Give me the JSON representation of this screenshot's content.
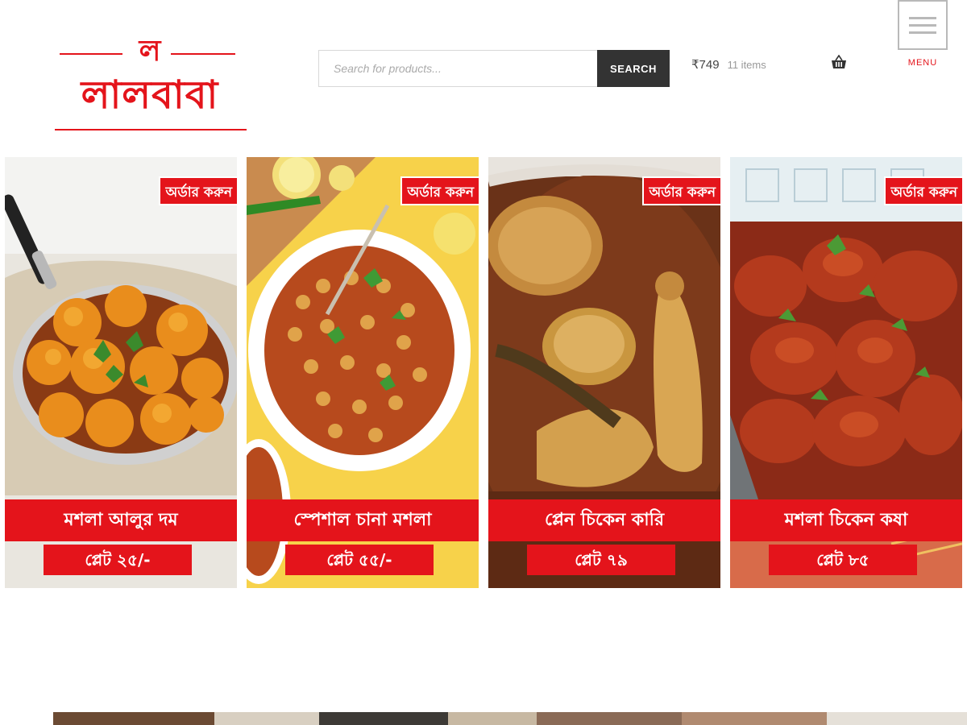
{
  "header": {
    "logo_top": "ল",
    "logo_main": "লালবাবা"
  },
  "search": {
    "placeholder": "Search for products...",
    "button_label": "SEARCH"
  },
  "cart": {
    "amount": "₹749",
    "count": "11 items"
  },
  "menu": {
    "label": "MENU"
  },
  "products": [
    {
      "order_label": "অর্ডার করুন",
      "name": "মশলা আলুর দম",
      "price": "প্লেট ২৫/-",
      "icon": "aloo-dum-photo"
    },
    {
      "order_label": "অর্ডার করুন",
      "name": "স্পেশাল চানা মশলা",
      "price": "প্লেট ৫৫/-",
      "icon": "chana-masala-photo"
    },
    {
      "order_label": "অর্ডার করুন",
      "name": "প্লেন  চিকেন কারি",
      "price": "প্লেট ৭৯",
      "icon": "chicken-curry-photo"
    },
    {
      "order_label": "অর্ডার করুন",
      "name": "মশলা চিকেন কষা",
      "price": "প্লেট ৮৫",
      "icon": "chicken-kosha-photo"
    }
  ],
  "colors": {
    "brand_red": "#e4141b",
    "search_button": "#333333"
  }
}
